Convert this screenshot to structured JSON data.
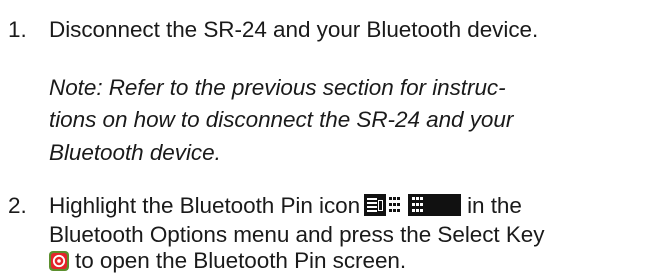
{
  "items": [
    {
      "number": "1.",
      "text": "Disconnect the SR-24 and your Bluetooth device."
    },
    {
      "number": "2.",
      "line1_before": "Highlight the Bluetooth Pin icon",
      "line1_after": "in the",
      "line2": "Bluetooth Options menu and press the Select Key",
      "line3": "to open the Bluetooth Pin screen."
    }
  ],
  "note": {
    "line1": "Note: Refer to the previous section for instruc-",
    "line2": "tions on how to disconnect the SR-24 and your",
    "line3": "Bluetooth device."
  },
  "icons": {
    "bluetooth_pin": "bluetooth-pin-icon",
    "select_key": "select-key-icon",
    "select_key_color": "#e4232b",
    "select_key_ring": "#5b8f2e"
  }
}
